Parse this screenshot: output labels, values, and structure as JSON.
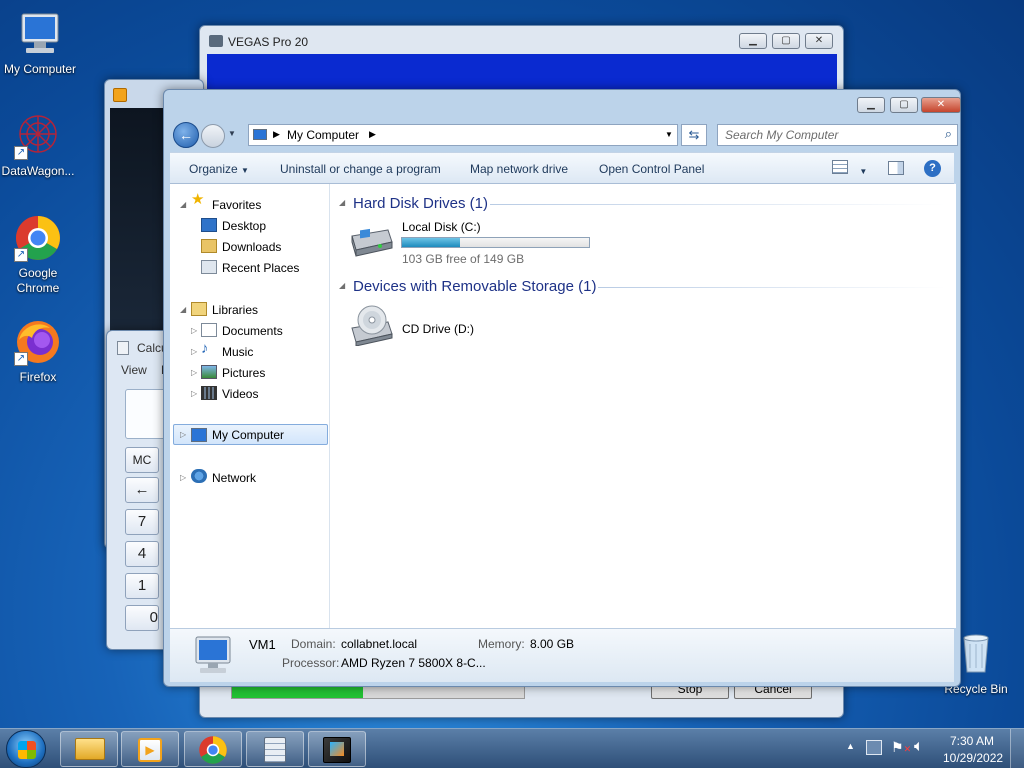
{
  "desktop": {
    "icons": [
      {
        "label": "My Computer",
        "icon": "computer-icon"
      },
      {
        "label": "DataWagon...",
        "icon": "datawagon-icon"
      },
      {
        "label": "Google Chrome",
        "icon": "chrome-icon"
      },
      {
        "label": "Firefox",
        "icon": "firefox-icon"
      },
      {
        "label": "Recycle Bin",
        "icon": "recycle-bin-icon"
      }
    ]
  },
  "vegas": {
    "title": "VEGAS Pro 20",
    "stop_label": "Stop",
    "cancel_label": "Cancel",
    "progress": 0.45,
    "colors": {
      "client": "#0a2ad0",
      "progress": "#22c232"
    }
  },
  "calculator": {
    "title": "Calcu",
    "menu_view": "View",
    "menu_edit": "E",
    "keys": [
      "MC",
      "←",
      "7",
      "4",
      "1",
      "0"
    ]
  },
  "explorer": {
    "breadcrumb": "My Computer",
    "search_placeholder": "Search My Computer",
    "commands": {
      "organize": "Organize",
      "uninstall": "Uninstall or change a program",
      "map_drive": "Map network drive",
      "control_panel": "Open Control Panel"
    },
    "nav": {
      "favorites": "Favorites",
      "desktop": "Desktop",
      "downloads": "Downloads",
      "recent": "Recent Places",
      "libraries": "Libraries",
      "documents": "Documents",
      "music": "Music",
      "pictures": "Pictures",
      "videos": "Videos",
      "computer": "My Computer",
      "network": "Network"
    },
    "groups": {
      "hdd": "Hard Disk Drives (1)",
      "removable": "Devices with Removable Storage (1)"
    },
    "drives": {
      "c_name": "Local Disk (C:)",
      "c_free": "103 GB free of 149 GB",
      "c_used_fraction": 0.31,
      "d_name": "CD Drive (D:)"
    },
    "details": {
      "name": "VM1",
      "domain_label": "Domain:",
      "domain": "collabnet.local",
      "memory_label": "Memory:",
      "memory": "8.00 GB",
      "processor_label": "Processor:",
      "processor": "AMD Ryzen 7 5800X 8-C..."
    }
  },
  "taskbar": {
    "apps": [
      "start-orb",
      "file-explorer",
      "media-player",
      "chrome",
      "calculator",
      "vegas-pro"
    ],
    "time": "7:30 AM",
    "date": "10/29/2022"
  }
}
